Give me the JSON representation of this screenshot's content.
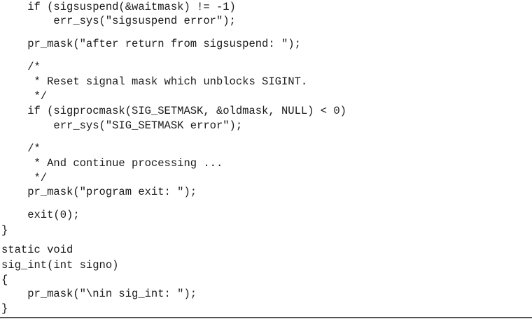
{
  "code": {
    "lines": [
      "    if (sigsuspend(&waitmask) != -1)",
      "        err_sys(\"sigsuspend error\");",
      "    pr_mask(\"after return from sigsuspend: \");",
      "    /*",
      "     * Reset signal mask which unblocks SIGINT.",
      "     */",
      "    if (sigprocmask(SIG_SETMASK, &oldmask, NULL) < 0)",
      "        err_sys(\"SIG_SETMASK error\");",
      "    /*",
      "     * And continue processing ...",
      "     */",
      "    pr_mask(\"program exit: \");",
      "    exit(0);",
      "}",
      "static void",
      "sig_int(int signo)",
      "{",
      "    pr_mask(\"\\nin sig_int: \");",
      "}"
    ]
  }
}
